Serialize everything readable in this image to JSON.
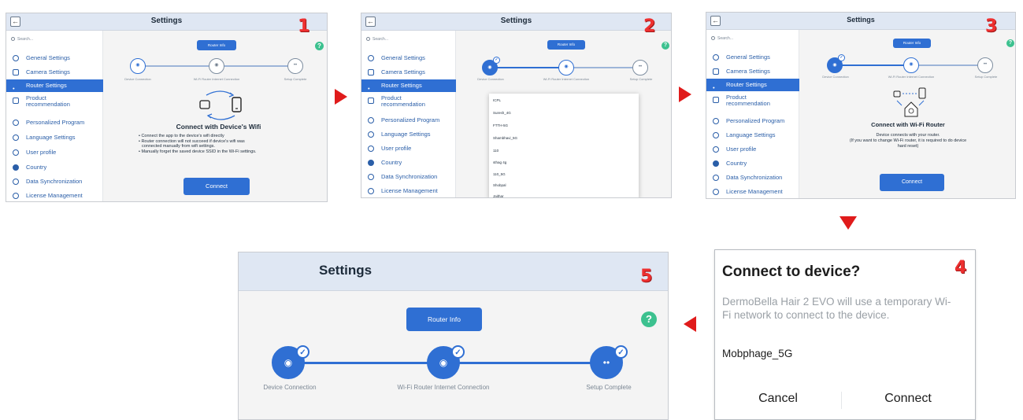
{
  "step_numbers": [
    "1",
    "2",
    "3",
    "4",
    "5"
  ],
  "settings_title": "Settings",
  "search_placeholder": "Search...",
  "sidebar": {
    "items": [
      "General Settings",
      "Camera Settings",
      "Router Settings",
      "Product recommendation",
      "Personalized Program",
      "Language Settings",
      "User profile",
      "Country",
      "Data Synchronization",
      "License Management"
    ]
  },
  "router_info_button": "Router Info",
  "help_symbol": "?",
  "steps": [
    "Device Connection",
    "Wi-Fi Router Internet Connection",
    "Setup Complete"
  ],
  "panel1": {
    "heading": "Connect with Device's Wifi",
    "bullets": [
      "• Connect the app to the device's wifi directly",
      "• Router connection will not succeed if device's wifi was",
      "connected manually from wifi settings.",
      "• Manually forget the saved device SSID in the Wi-Fi settings."
    ],
    "connect_button": "Connect"
  },
  "panel2": {
    "wifi_networks": [
      "ICPL",
      "Suresh_4G",
      "FTTH-5G",
      "Shambhavi_5G",
      "110",
      "sthag 4g",
      "110_5G",
      "Shobpal",
      "Jaithar"
    ]
  },
  "panel3": {
    "heading": "Connect with Wi-Fi Router",
    "description": "Device connects with your router.",
    "description2": "(If you want to change Wi-Fi router, it is required to do device",
    "description3": "hard reset)",
    "connect_button": "Connect"
  },
  "dialog": {
    "title": "Connect to device?",
    "message": "DermoBella Hair 2 EVO will use a temporary Wi-Fi network to connect to the device.",
    "network": "Mobphage_5G",
    "cancel": "Cancel",
    "connect": "Connect"
  },
  "colors": {
    "accent": "#2f6fd3",
    "header": "#dfe7f3",
    "help": "#3cc18f",
    "arrow": "#e01b1b"
  }
}
